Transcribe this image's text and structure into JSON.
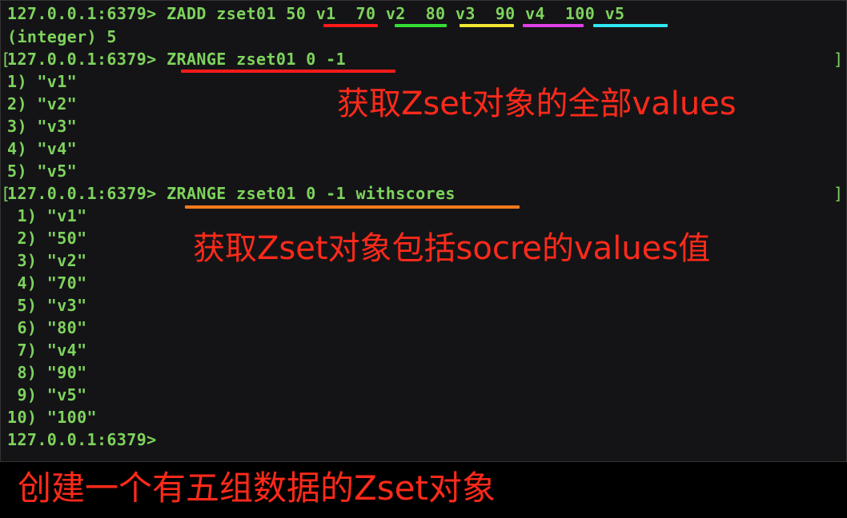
{
  "terminal": {
    "cmd1": {
      "prompt": "127.0.0.1:6379>",
      "command": "ZADD zset01",
      "pairs": [
        "50 v1",
        "70 v2",
        "80 v3",
        "90 v4",
        "100 v5"
      ]
    },
    "reply1": "(integer) 5",
    "cmd2": {
      "prompt": "127.0.0.1:6379>",
      "command": "ZRANGE zset01 0 -1"
    },
    "result2": [
      "1) \"v1\"",
      "2) \"v2\"",
      "3) \"v3\"",
      "4) \"v4\"",
      "5) \"v5\""
    ],
    "cmd3": {
      "prompt": "127.0.0.1:6379>",
      "command": "ZRANGE zset01 0 -1 withscores"
    },
    "result3": [
      " 1) \"v1\"",
      " 2) \"50\"",
      " 3) \"v2\"",
      " 4) \"70\"",
      " 5) \"v3\"",
      " 6) \"80\"",
      " 7) \"v4\"",
      " 8) \"90\"",
      " 9) \"v5\"",
      "10) \"100\""
    ],
    "final_prompt": "127.0.0.1:6379>",
    "bracket_left": "[",
    "bracket_right": "]"
  },
  "annotations": {
    "zrange_all": "获取Zset对象的全部values",
    "zrange_withscores": "获取Zset对象包括socre的values值",
    "zadd_create": "创建一个有五组数据的Zset对象"
  },
  "colors": {
    "terminal_text": "#7ed35c",
    "annotation": "#ff2a1a",
    "underline_v1": "#ff1a1a",
    "underline_v2": "#33e033",
    "underline_v3": "#f2e633",
    "underline_v4": "#e040e6",
    "underline_v5": "#2ee6f0",
    "underline_zrange": "#ff1a1a",
    "underline_withscores": "#ff7a1a"
  }
}
